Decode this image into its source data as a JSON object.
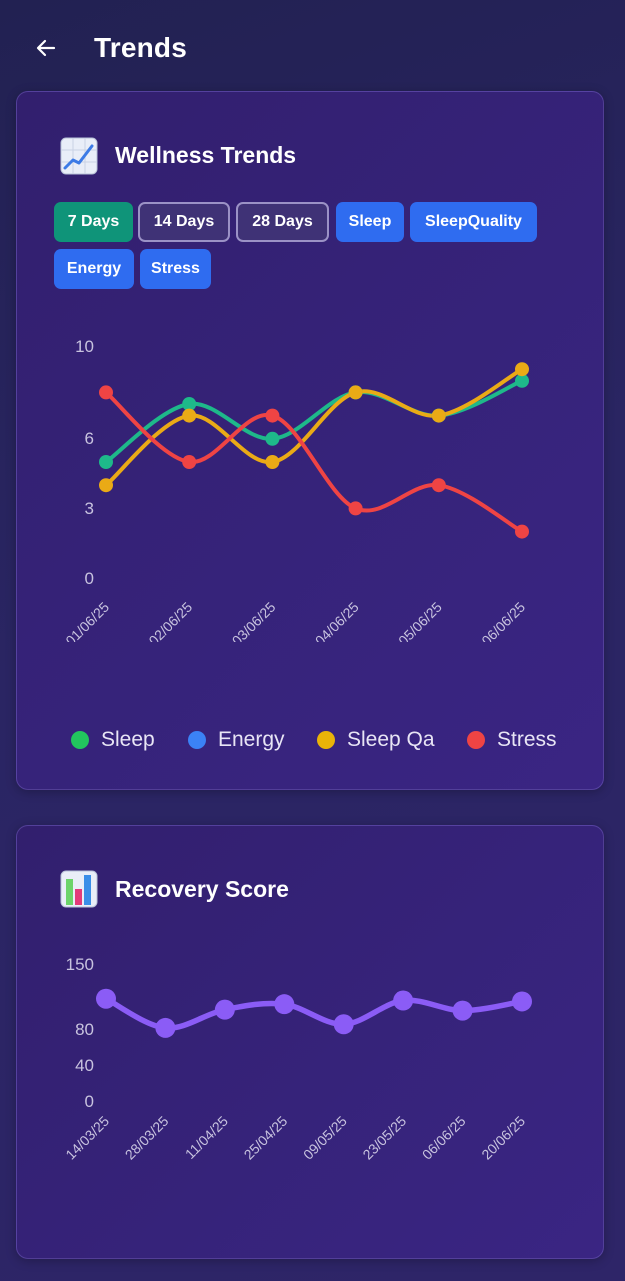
{
  "header": {
    "title": "Trends"
  },
  "wellness": {
    "title": "Wellness Trends",
    "buttons": [
      {
        "label": "7 Days",
        "style": "green"
      },
      {
        "label": "14 Days",
        "style": "outline"
      },
      {
        "label": "28 Days",
        "style": "outline"
      },
      {
        "label": "Sleep",
        "style": "blue"
      },
      {
        "label": "SleepQuality",
        "style": "blue"
      },
      {
        "label": "Energy",
        "style": "blue"
      },
      {
        "label": "Stress",
        "style": "blue"
      }
    ],
    "legend": [
      {
        "label": "Sleep",
        "color": "#22c55e"
      },
      {
        "label": "Energy",
        "color": "#3b82f6"
      },
      {
        "label": "Sleep Qa",
        "color": "#eab308"
      },
      {
        "label": "Stress",
        "color": "#ef4444"
      }
    ]
  },
  "recovery": {
    "title": "Recovery Score"
  },
  "chart_data": [
    {
      "type": "line",
      "title": "Wellness Trends",
      "x": [
        "01/06/25",
        "02/06/25",
        "03/06/25",
        "04/06/25",
        "05/06/25",
        "06/06/25"
      ],
      "yticks": [
        10,
        6,
        3,
        0
      ],
      "ylim": [
        0,
        10
      ],
      "series": [
        {
          "name": "Sleep",
          "color": "#1eb98a",
          "values": [
            5,
            7.5,
            6,
            8,
            7,
            8.5
          ]
        },
        {
          "name": "Sleep Qa",
          "color": "#eaaa16",
          "values": [
            4,
            7,
            5,
            8,
            7,
            9
          ]
        },
        {
          "name": "Stress",
          "color": "#ef4444",
          "values": [
            8,
            5,
            7,
            3,
            4,
            2
          ]
        }
      ],
      "legend_position": "bottom"
    },
    {
      "type": "line",
      "title": "Recovery Score",
      "x": [
        "14/03/25",
        "28/03/25",
        "11/04/25",
        "25/04/25",
        "09/05/25",
        "23/05/25",
        "06/06/25",
        "20/06/25"
      ],
      "yticks": [
        150,
        80,
        40,
        0
      ],
      "ylim": [
        0,
        150
      ],
      "series": [
        {
          "name": "Recovery Score",
          "color": "#8b5cf6",
          "values": [
            112,
            80,
            100,
            106,
            84,
            110,
            99,
            109
          ]
        }
      ]
    }
  ]
}
